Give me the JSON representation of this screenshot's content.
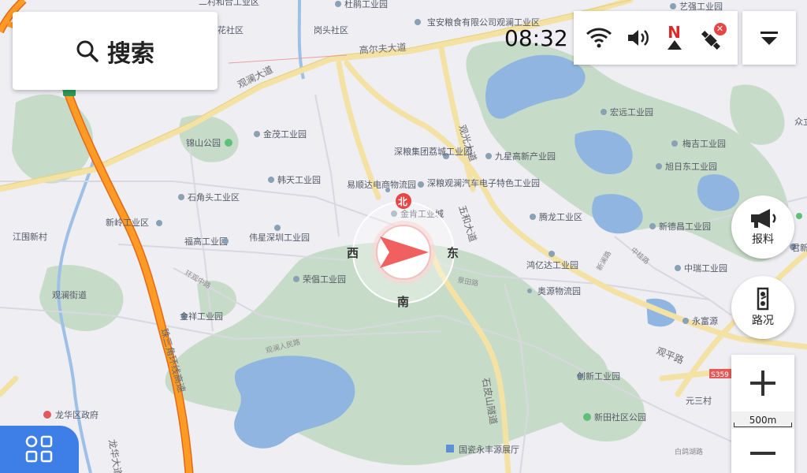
{
  "search": {
    "label": "搜索",
    "icon": "search-icon"
  },
  "status_bar": {
    "time": "08:32",
    "icons": [
      "wifi-icon",
      "volume-icon",
      "north-up-icon",
      "gps-off-icon"
    ],
    "north_label": "N"
  },
  "side_buttons": {
    "report_label": "报料",
    "traffic_label": "路况"
  },
  "zoom": {
    "scale_label": "500m"
  },
  "compass": {
    "north": "北",
    "south": "南",
    "east": "东",
    "west": "西"
  },
  "map": {
    "roads": {
      "gaoerfu": "高尔夫大道",
      "guanlan": "观澜大道",
      "guanguang": "观光大道",
      "wuhe": "五和大道",
      "guanping": "观平路",
      "shipi": "石皮山隧道",
      "ring": "珠三角环线高速",
      "huanzhong": "环观中路",
      "renmin": "观澜人民路",
      "jingtian": "景田路",
      "zhonggui": "中桂路",
      "xinlan": "新澜路",
      "longhua": "龙华大道",
      "s359": "S359",
      "baihu": "白鸽湖路"
    },
    "pois": [
      "二村和合工业区",
      "杜鹃工业园",
      "宝安粮食有限公司观澜工业区",
      "艺强工业园",
      "花社区",
      "岗头社区",
      "金茂工业园",
      "锦山公园",
      "深粮集团荔城工业园",
      "宏远工业园",
      "梅吉工业园",
      "众立",
      "韩天工业园",
      "九星高新产业园",
      "旭日东工业园",
      "易顺达电商物流园",
      "深粮观澜汽车电子特色工业园",
      "石角头工业区",
      "新岭工业区",
      "金肯工业城",
      "腾龙工业区",
      "福高工业园",
      "伟星深圳工业园",
      "新德昌工业园",
      "中瑞工业园",
      "华",
      "君新",
      "江围新村",
      "鸿亿达工业园",
      "荣倡工业园",
      "奥源物流园",
      "观澜街道",
      "永富源",
      "金祥工业园",
      "创新工业园",
      "元三村",
      "新田社区公园",
      "龙华区政府",
      "国瓷永丰源展厅"
    ]
  }
}
